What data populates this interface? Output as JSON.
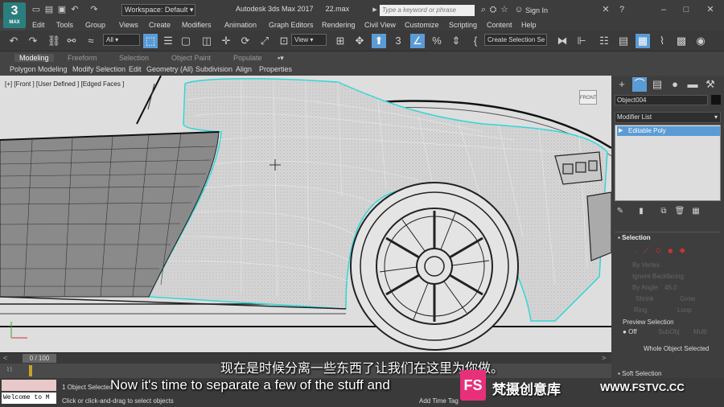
{
  "app": {
    "logo_text": "3",
    "logo_sub": "MAX",
    "title": "Autodesk 3ds Max 2017",
    "file": "22.max",
    "workspace": "Workspace: Default",
    "search_placeholder": "Type a keyword or phrase",
    "sign_in": "Sign In"
  },
  "menu": [
    "Edit",
    "Tools",
    "Group",
    "Views",
    "Create",
    "Modifiers",
    "Animation",
    "Graph Editors",
    "Rendering",
    "Civil View",
    "Customize",
    "Scripting",
    "Content",
    "Help"
  ],
  "toolbar": {
    "filter": "All",
    "ref_coord": "View",
    "selection_set": "Create Selection Se"
  },
  "ribbon": {
    "tabs": [
      "Modeling",
      "Freeform",
      "Selection",
      "Object Paint",
      "Populate"
    ],
    "subtabs": [
      "Polygon Modeling",
      "Modify Selection",
      "Edit",
      "Geometry (All)",
      "Subdivision",
      "Align",
      "Properties"
    ]
  },
  "viewport": {
    "label": "[+] [Front ] [User Defined ] [Edged Faces ]",
    "cube_label": "FRONT"
  },
  "command_panel": {
    "object_name": "Object004",
    "modifier_list": "Modifier List",
    "stack_item": "Editable Poly",
    "selection_title": "Selection",
    "by_vertex": "By Vertex",
    "ignore_backfacing": "Ignore Backfacing",
    "by_angle": "By Angle:",
    "angle_value": "45.0",
    "shrink": "Shrink",
    "grow": "Grow",
    "ring": "Ring",
    "loop": "Loop",
    "preview_selection": "Preview Selection",
    "off": "Off",
    "subobj": "SubObj",
    "multi": "Multi",
    "whole_object": "Whole Object Selected",
    "soft_selection": "Soft Selection"
  },
  "timeline": {
    "position": "0 / 100"
  },
  "status": {
    "maxscript": "Welcome to M",
    "selected": "1 Object Selected",
    "prompt": "Click or click-and-drag to select objects",
    "add_time_tag": "Add Time Tag"
  },
  "subtitles": {
    "chinese": "现在是时候分离一些东西了让我们在这里为你做。",
    "english": "Now it's time to separate a few of the stuff and"
  },
  "watermark": {
    "logo": "FS",
    "text": "梵摄创意库",
    "url": "WWW.FSTVC.CC"
  }
}
